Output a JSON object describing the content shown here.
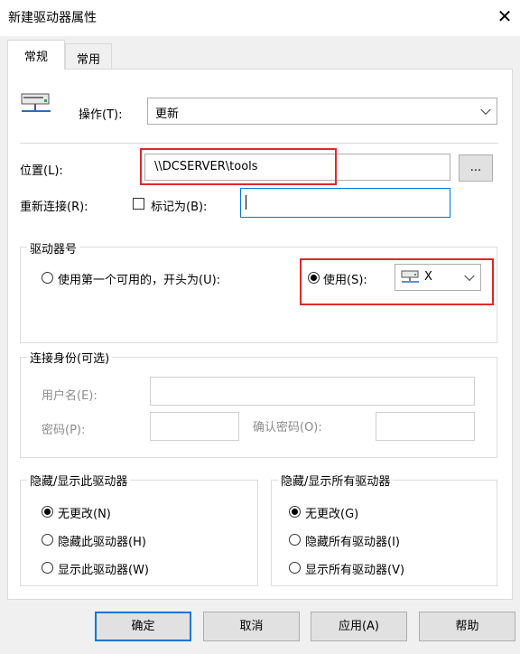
{
  "window": {
    "title": "新建驱动器属性",
    "close_glyph": "✕"
  },
  "tabs": [
    {
      "label": "常规",
      "active": true
    },
    {
      "label": "常用",
      "active": false
    }
  ],
  "operation": {
    "label": "操作(T):",
    "value": "更新",
    "icon": "network-drive-icon"
  },
  "location": {
    "label": "位置(L):",
    "value": "\\\\DCSERVER\\tools",
    "browse_label": "..."
  },
  "reconnect": {
    "label": "重新连接(R):",
    "checkbox_label": "标记为(B):",
    "checked": false,
    "label_value": ""
  },
  "drive_letter": {
    "legend": "驱动器号",
    "option_first": "使用第一个可用的，开头为(U):",
    "option_use": "使用(S):",
    "selected": "use",
    "drive_value": "X",
    "drive_icon": "network-drive-icon"
  },
  "identity": {
    "legend": "连接身份(可选)",
    "username_label": "用户名(E):",
    "password_label": "密码(P):",
    "confirm_label": "确认密码(O):"
  },
  "hide_this": {
    "legend": "隐藏/显示此驱动器",
    "options": [
      "无更改(N)",
      "隐藏此驱动器(H)",
      "显示此驱动器(W)"
    ],
    "selected_index": 0
  },
  "hide_all": {
    "legend": "隐藏/显示所有驱动器",
    "options": [
      "无更改(G)",
      "隐藏所有驱动器(I)",
      "显示所有驱动器(V)"
    ],
    "selected_index": 0
  },
  "buttons": {
    "ok": "确定",
    "cancel": "取消",
    "apply": "应用(A)",
    "help": "帮助"
  },
  "colors": {
    "highlight": "#e3262b",
    "focus": "#0078d7"
  }
}
